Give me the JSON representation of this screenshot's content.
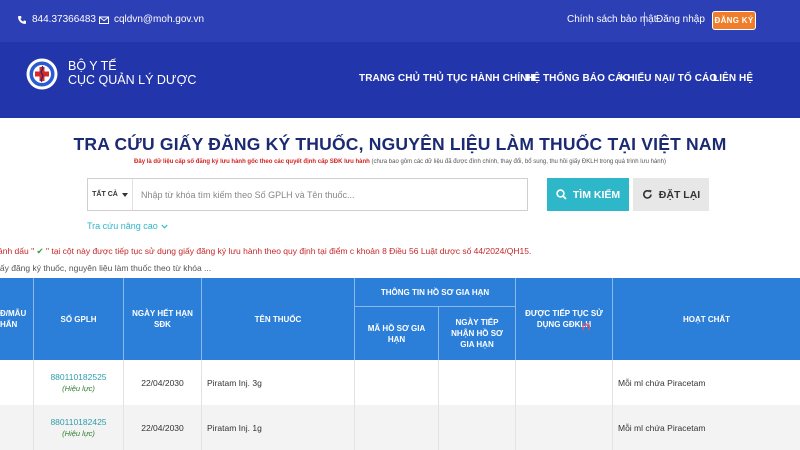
{
  "topbar": {
    "phone": "844.37366483",
    "email": "cqldvn@moh.gov.vn",
    "privacy": "Chính sách bảo mật",
    "login": "Đăng nhập",
    "register": "ĐĂNG KÝ"
  },
  "brand": {
    "line1": "BỘ Y TẾ",
    "line2": "CỤC QUẢN LÝ DƯỢC"
  },
  "nav": [
    "TRANG CHỦ",
    "THỦ TỤC HÀNH CHÍNH",
    "HỆ THỐNG BÁO CÁO",
    "KHIẾU NẠI/ TỐ CÁO",
    "LIÊN HỆ"
  ],
  "search": {
    "title": "TRA CỨU GIẤY ĐĂNG KÝ THUỐC, NGUYÊN LIỆU LÀM THUỐC TẠI VIỆT NAM",
    "note_red": "Đây là dữ liệu cấp số đăng ký lưu hành gốc theo các quyết định cấp SĐK lưu hành",
    "note_grey": " (chưa bao gồm các dữ liệu đã được đính chính, thay đổi, bổ sung, thu hồi giấy ĐKLH trong quá trình lưu hành)",
    "scope": "TẤT CẢ",
    "placeholder": "Nhập từ khóa tìm kiếm theo Số GPLH và Tên thuốc...",
    "search_label": "TÌM KIẾM",
    "reset_label": "ĐẶT LẠI",
    "advanced": "Tra cứu nâng cao"
  },
  "notes": {
    "n1_pre": "ánh dấu \" ",
    "n1_tick": "✔",
    "n1_post": " \" tại cột này được tiếp tục sử dụng giấy đăng ký lưu hành theo quy định tại điểm c khoản 8 Điều 56 Luật dược số 44/2024/QH15.",
    "n2": "iấy đăng ký thuốc, nguyên liệu làm thuốc theo từ khóa ..."
  },
  "table": {
    "headers": {
      "c0": "Đ/MẪU\nHẨN",
      "c1": "SỐ GPLH",
      "c2": "NGÀY HẾT HẠN\nSĐK",
      "c3": "TÊN THUỐC",
      "group": "THÔNG TIN HỒ SƠ GIA HẠN",
      "sub1": "MÃ HỒ SƠ GIA\nHẠN",
      "sub2": "NGÀY TIẾP\nNHẬN HỒ SƠ\nGIA HẠN",
      "c6": "ĐƯỢC TIẾP TỤC SỬ\nDỤNG GĐKLH",
      "c6_star": " (*)",
      "c7": "HOẠT CHẤT"
    },
    "rows": [
      {
        "code": "880110182525",
        "status": "(Hiệu lực)",
        "expiry": "22/04/2030",
        "name": "Piratam Inj. 3g",
        "active": "Mỗi ml chứa Piracetam"
      },
      {
        "code": "880110182425",
        "status": "(Hiệu lực)",
        "expiry": "22/04/2030",
        "name": "Piratam Inj. 1g",
        "active": "Mỗi ml chứa Piracetam"
      }
    ]
  },
  "colors": {
    "topbar": "#2d3fb5",
    "navband": "#2235ab",
    "accent": "#2eb6c9",
    "register": "#f07d29",
    "table_header": "#2c7fd9"
  }
}
